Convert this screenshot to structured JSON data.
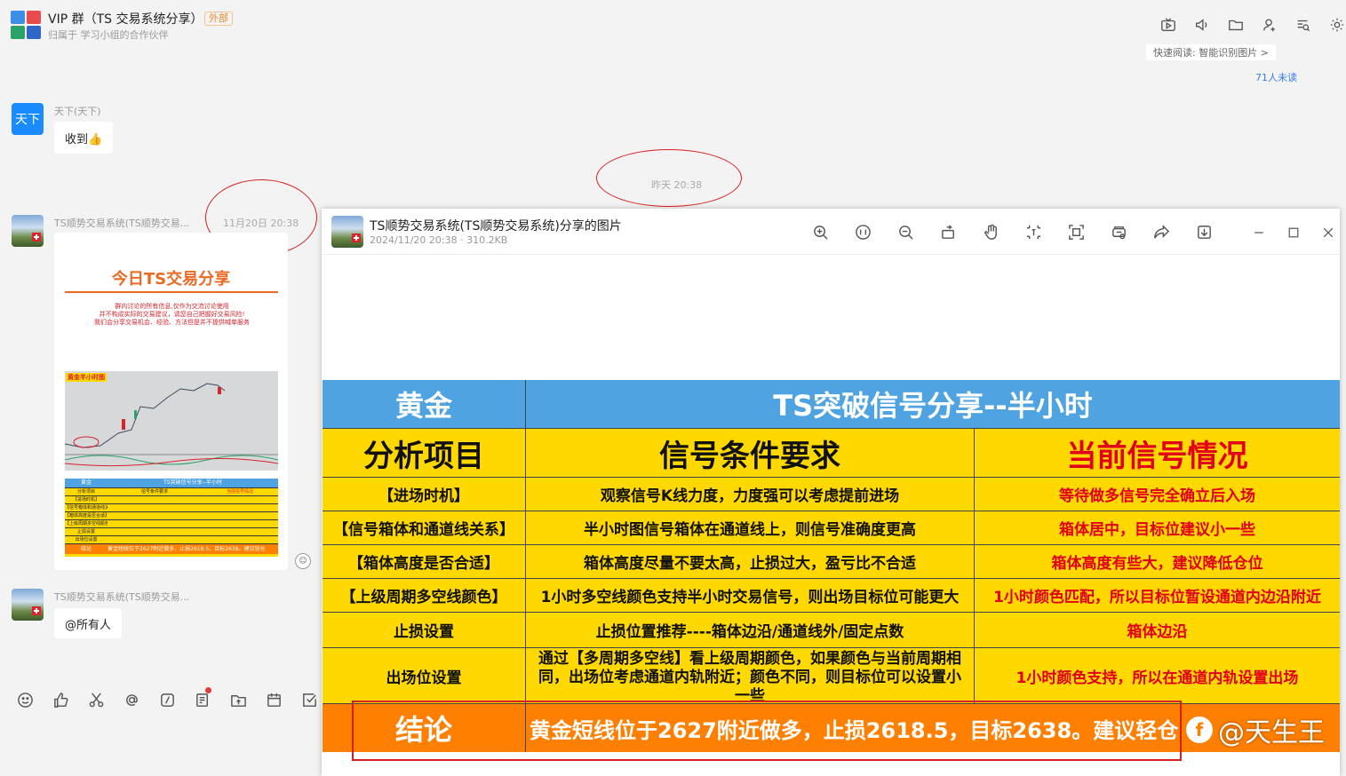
{
  "header": {
    "title": "VIP 群（TS 交易系统分享）",
    "badge": "外部",
    "subtitle": "归属于 学习小组的合作伙伴",
    "icons": [
      "video-icon",
      "speaker-icon",
      "folder-icon",
      "add-user-icon",
      "list-search-icon",
      "settings-icon"
    ]
  },
  "quick_read": "快速阅读: 智能识别图片 >",
  "unread": "71人未读",
  "messages": [
    {
      "avatar_text": "天下",
      "sender": "天下(天下)",
      "text": "收到👍"
    },
    {
      "sender": "TS顺势交易系统(TS顺势交易...",
      "time": "11月20日 20:38"
    },
    {
      "sender": "TS顺势交易系统(TS顺势交易...",
      "text": "@所有人"
    }
  ],
  "divider_time": "昨天 20:38",
  "thumbnail": {
    "title": "今日TS交易分享",
    "notes": [
      "群内讨论的所有信息,仅作为交流讨论使用",
      "并不构成实际的交易建议，请您自己把握好交易风险!",
      "我们会分享交易机会、经验、方法但是并不提供喊单服务"
    ],
    "chart_label": "黄金半小时图",
    "table_head": [
      "黄金",
      "TS突破信号分享--半小时"
    ],
    "table_rows": [
      [
        "分析项目",
        "信号条件要求",
        "当前信号情况"
      ],
      [
        "【进场时机】",
        "",
        ""
      ],
      [
        "【信号箱体和通道线关系】",
        "",
        ""
      ],
      [
        "【箱体高度是否合适】",
        "",
        ""
      ],
      [
        "【上级周期多空线颜色】",
        "",
        ""
      ],
      [
        "止损设置",
        "",
        ""
      ],
      [
        "出场位设置",
        "",
        ""
      ]
    ],
    "table_foot": [
      "结论",
      "黄金短线位于2627附近做多，止损2618.5，目标2638。建议轻仓"
    ]
  },
  "viewer": {
    "title": "TS顺势交易系统(TS顺势交易系统)分享的图片",
    "meta": "2024/11/20 20:38 · 310.2KB",
    "tools": [
      "zoom-in-icon",
      "actual-size-icon",
      "zoom-out-icon",
      "rotate-icon",
      "hand-icon",
      "crop-icon",
      "screenshot-icon",
      "ocr-icon",
      "share-icon",
      "download-icon"
    ],
    "window": [
      "minimize-icon",
      "maximize-icon",
      "close-icon"
    ]
  },
  "table": {
    "head": [
      "黄金",
      "TS突破信号分享--半小时"
    ],
    "columns": [
      "分析项目",
      "信号条件要求",
      "当前信号情况"
    ],
    "rows": [
      [
        "【进场时机】",
        "观察信号K线力度，力度强可以考虑提前进场",
        "等待做多信号完全确立后入场"
      ],
      [
        "【信号箱体和通道线关系】",
        "半小时图信号箱体在通道线上，则信号准确度更高",
        "箱体居中，目标位建议小一些"
      ],
      [
        "【箱体高度是否合适】",
        "箱体高度尽量不要太高，止损过大，盈亏比不合适",
        "箱体高度有些大，建议降低仓位"
      ],
      [
        "【上级周期多空线颜色】",
        "1小时多空线颜色支持半小时交易信号，则出场目标位可能更大",
        "1小时颜色匹配，所以目标位暂设通道内边沿附近"
      ],
      [
        "止损设置",
        "止损位置推荐----箱体边沿/通道线外/固定点数",
        "箱体边沿"
      ],
      [
        "出场位设置",
        "通过【多周期多空线】看上级周期颜色，如果颜色与当前周期相同，出场位考虑通道内轨附近；颜色不同，则目标位可以设置小一些",
        "1小时颜色支持，所以在通道内轨设置出场"
      ]
    ],
    "conclusion_label": "结论",
    "conclusion": "黄金短线位于2627附近做多，止损2618.5，目标2638。建议轻仓"
  },
  "watermark": "@天生王",
  "composer_icons": [
    "emoji-icon",
    "thumbs-up-icon",
    "scissors-icon",
    "mention-icon",
    "slash-command-icon",
    "notes-icon",
    "upload-folder-icon",
    "calendar-icon",
    "checkbox-icon"
  ],
  "colors": {
    "blue_header": "#4fa3e0",
    "yellow": "#ffd800",
    "orange": "#ff7f00",
    "red_text": "#e0001a",
    "annotation_red": "#d81e1e"
  }
}
